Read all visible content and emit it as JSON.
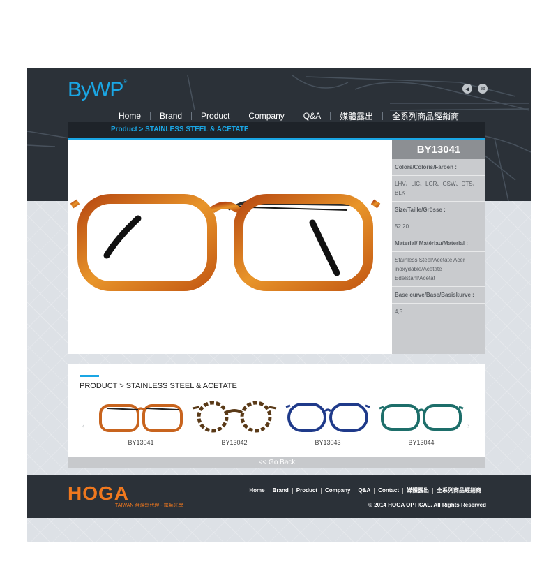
{
  "header": {
    "logo": "ByWP",
    "logo_mark": "®",
    "icons": [
      "speaker-icon",
      "mail-icon"
    ]
  },
  "nav": {
    "items": [
      "Home",
      "Brand",
      "Product",
      "Company",
      "Q&A",
      "媒體露出",
      "全系列商品經銷商"
    ]
  },
  "breadcrumb": "Product > STAINLESS STEEL & ACETATE",
  "detail": {
    "model": "BY13041",
    "rows": [
      {
        "label": "Colors/Coloris/Farben :",
        "value": "LHV、LIC、LGR、GSW、DTS、BLK"
      },
      {
        "label": "Size/Taille/Grösse :",
        "value": "52 20"
      },
      {
        "label": "Material/ Matériau/Material :",
        "value": "Stainless Steel/Acetate Acer inoxydable/Acétate Edelstahl/Acetat"
      },
      {
        "label": "Base curve/Base/Basiskurve :",
        "value": "4,5"
      }
    ]
  },
  "products": {
    "title": "PRODUCT > STAINLESS STEEL & ACETATE",
    "items": [
      {
        "model": "BY13041",
        "color": "#c8641e"
      },
      {
        "model": "BY13042",
        "color": "#5a3a18"
      },
      {
        "model": "BY13043",
        "color": "#1f3a8a"
      },
      {
        "model": "BY13044",
        "color": "#1d6e6a"
      }
    ],
    "prev": "‹",
    "next": "›"
  },
  "go_back": "<< Go Back",
  "footer": {
    "brand": "HOGA",
    "brand_sub": "TAIWAN  台灣總代理 - 露藝光學",
    "nav": [
      "Home",
      "Brand",
      "Product",
      "Company",
      "Q&A",
      "Contact",
      "媒體露出",
      "全系列商品經銷商"
    ],
    "copyright": "© 2014 HOGA OPTICAL. All Rights Reserved"
  }
}
